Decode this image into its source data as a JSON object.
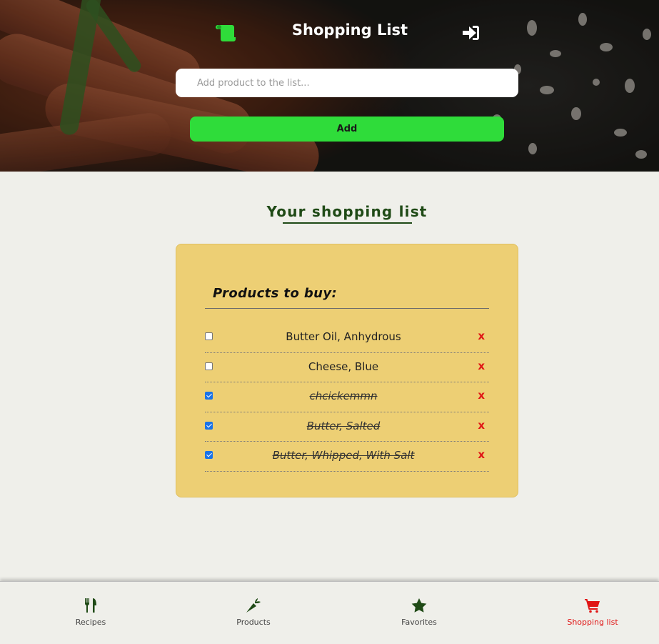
{
  "header": {
    "title": "Shopping List",
    "logo_icon": "scroll-icon",
    "login_icon": "sign-in-icon",
    "logo_color": "#2fdc3a"
  },
  "add_form": {
    "placeholder": "Add product to the list...",
    "value": "",
    "add_label": "Add",
    "button_color": "#2fdc3a"
  },
  "main": {
    "section_title": "Your shopping list",
    "card_title": "Products to buy:",
    "remove_label": "x",
    "items": [
      {
        "name": "Butter Oil, Anhydrous",
        "checked": false
      },
      {
        "name": "Cheese, Blue",
        "checked": false
      },
      {
        "name": "chcickemmn",
        "checked": true
      },
      {
        "name": "Butter, Salted",
        "checked": true
      },
      {
        "name": "Butter, Whipped, With Salt",
        "checked": true
      }
    ]
  },
  "nav": {
    "items": [
      {
        "label": "Recipes",
        "icon": "utensils-icon",
        "active": false
      },
      {
        "label": "Products",
        "icon": "carrot-icon",
        "active": false
      },
      {
        "label": "Favorites",
        "icon": "star-icon",
        "active": false
      },
      {
        "label": "Shopping list",
        "icon": "cart-icon",
        "active": true
      }
    ],
    "active_color": "#e01515",
    "icon_color": "#1f4a16"
  }
}
